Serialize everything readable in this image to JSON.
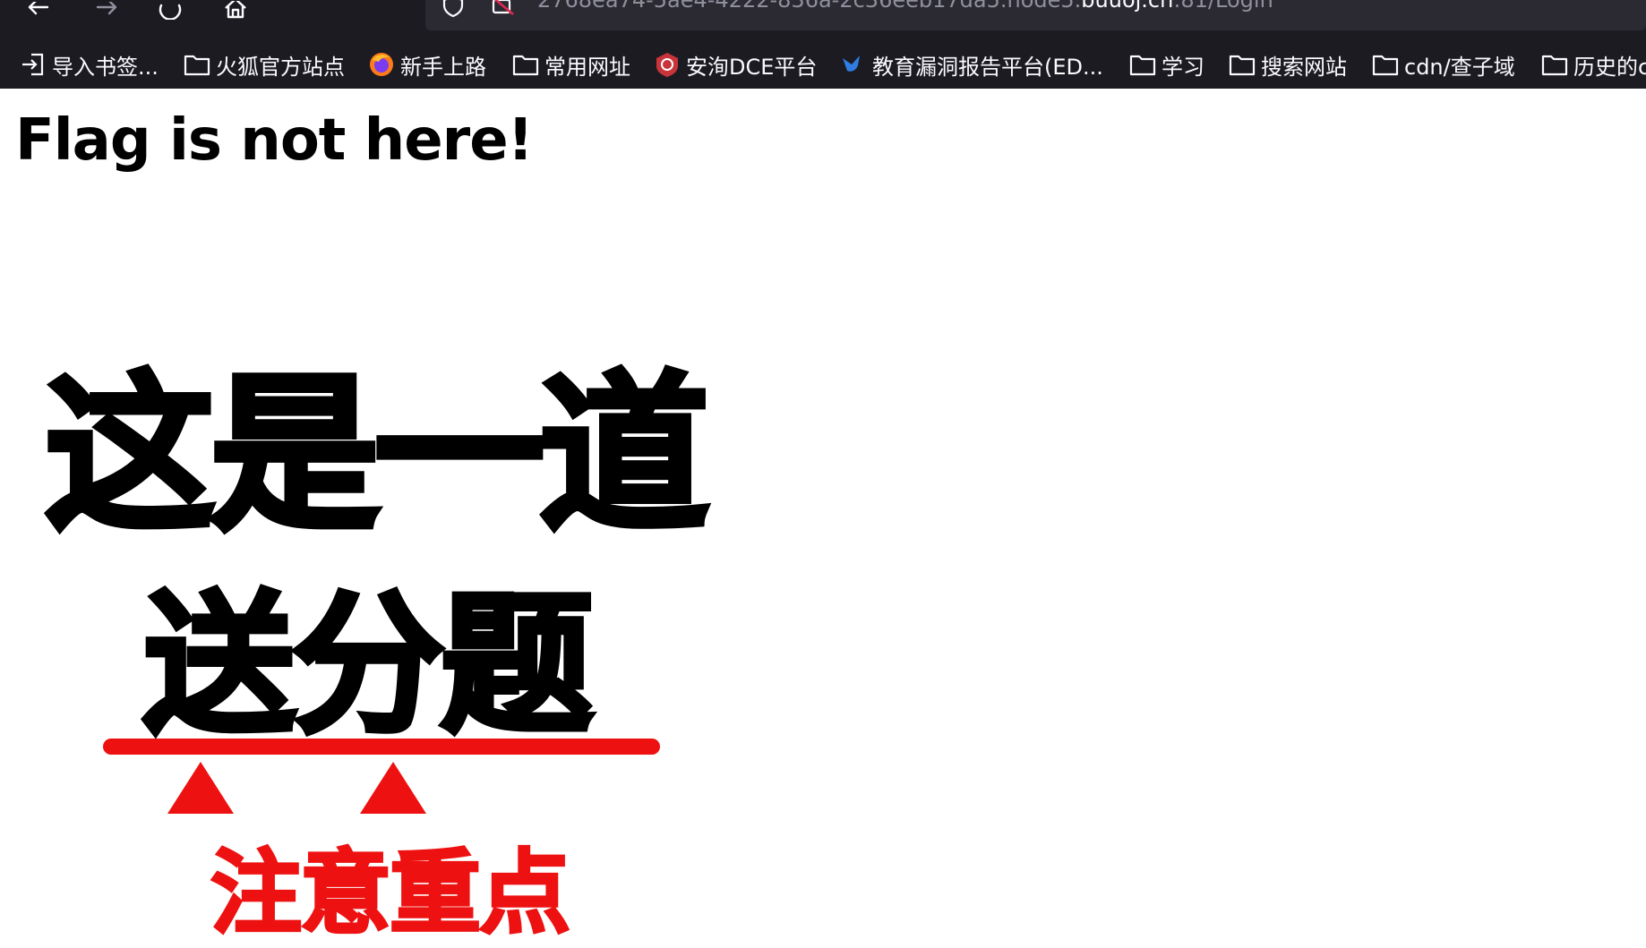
{
  "browser": {
    "url_prefix": "2768ea74-5ae4-4222-836a-2c36eeb17da5.node5.",
    "url_domain": "buuoj.cn",
    "url_suffix": ":81/Login",
    "bookmarks": [
      {
        "label": "导入书签...",
        "icon": "import-icon"
      },
      {
        "label": "火狐官方站点",
        "icon": "folder-icon"
      },
      {
        "label": "新手上路",
        "icon": "firefox-icon"
      },
      {
        "label": "常用网址",
        "icon": "folder-icon"
      },
      {
        "label": "安洵DCE平台",
        "icon": "shield-logo-icon"
      },
      {
        "label": "教育漏洞报告平台(ED...",
        "icon": "bird-icon"
      },
      {
        "label": "学习",
        "icon": "folder-icon"
      },
      {
        "label": "搜索网站",
        "icon": "folder-icon"
      },
      {
        "label": "cdn/查子域",
        "icon": "folder-icon"
      },
      {
        "label": "历史的c",
        "icon": "folder-icon"
      }
    ]
  },
  "page": {
    "heading": "Flag is not here!",
    "meme_line1": "这是一道",
    "meme_line2": "送分题",
    "meme_line3": "注意重点"
  },
  "colors": {
    "chrome_bg": "#1c1b22",
    "urlbar_bg": "#2b2a33",
    "accent_red": "#ee1111"
  }
}
